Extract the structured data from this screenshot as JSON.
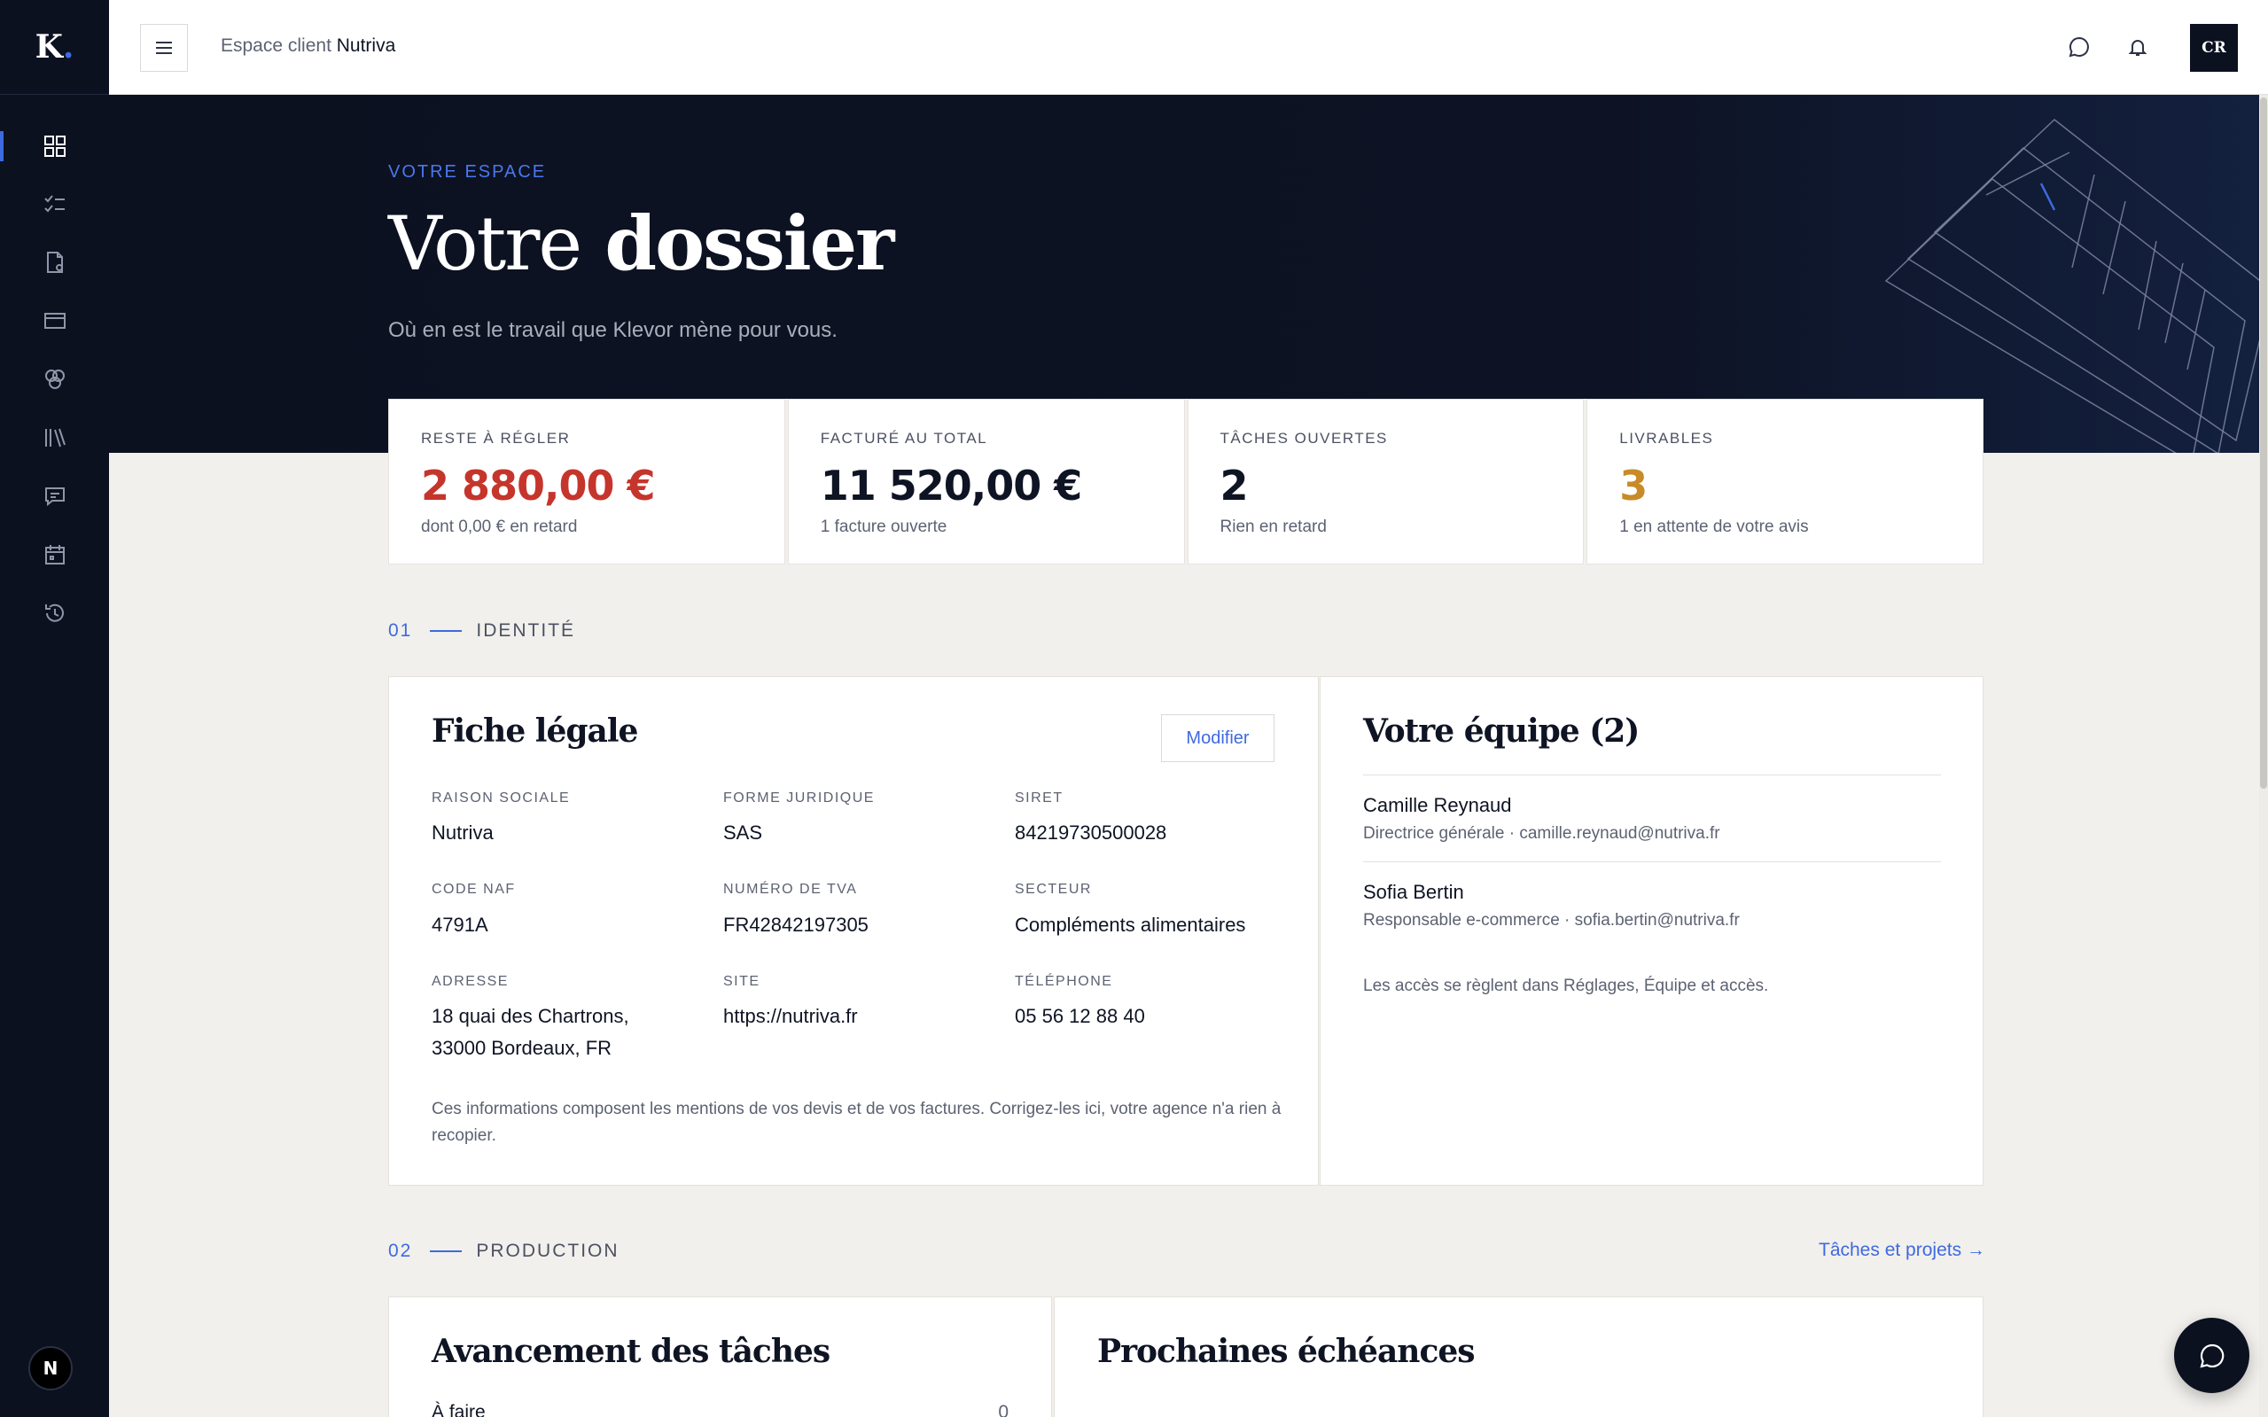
{
  "brand": {
    "logo_letter": "K",
    "logo_dot": "."
  },
  "sidebar": {
    "items": [
      {
        "icon": "dashboard-icon",
        "active": true
      },
      {
        "icon": "tasks-icon",
        "active": false
      },
      {
        "icon": "document-icon",
        "active": false
      },
      {
        "icon": "card-icon",
        "active": false
      },
      {
        "icon": "circles-icon",
        "active": false
      },
      {
        "icon": "library-icon",
        "active": false
      },
      {
        "icon": "message-icon",
        "active": false
      },
      {
        "icon": "calendar-icon",
        "active": false
      },
      {
        "icon": "history-icon",
        "active": false
      }
    ],
    "user_initial": "N"
  },
  "topbar": {
    "crumb_prefix": "Espace client",
    "crumb_client": "Nutriva",
    "user_initials": "CR"
  },
  "hero": {
    "eyebrow": "VOTRE ESPACE",
    "title_light": "Votre",
    "title_bold": "dossier",
    "subtitle": "Où en est le travail que Klevor mène pour vous."
  },
  "stats": [
    {
      "label": "RESTE À RÉGLER",
      "value": "2 880,00 €",
      "sub": "dont 0,00 € en retard",
      "tone": "red"
    },
    {
      "label": "FACTURÉ AU TOTAL",
      "value": "11 520,00 €",
      "sub": "1 facture ouverte",
      "tone": "default"
    },
    {
      "label": "TÂCHES OUVERTES",
      "value": "2",
      "sub": "Rien en retard",
      "tone": "default"
    },
    {
      "label": "LIVRABLES",
      "value": "3",
      "sub": "1 en attente de votre avis",
      "tone": "gold"
    }
  ],
  "section_identity": {
    "num": "01",
    "label": "IDENTITÉ"
  },
  "legal": {
    "title_light": "Fiche",
    "title_bold": "légale",
    "modify_label": "Modifier",
    "fields": [
      {
        "label": "RAISON SOCIALE",
        "value": "Nutriva"
      },
      {
        "label": "FORME JURIDIQUE",
        "value": "SAS"
      },
      {
        "label": "SIRET",
        "value": "84219730500028"
      },
      {
        "label": "CODE NAF",
        "value": "4791A"
      },
      {
        "label": "NUMÉRO DE TVA",
        "value": "FR42842197305"
      },
      {
        "label": "SECTEUR",
        "value": "Compléments alimentaires"
      },
      {
        "label": "ADRESSE",
        "value_line1": "18 quai des Chartrons,",
        "value_line2": "33000 Bordeaux, FR"
      },
      {
        "label": "SITE",
        "value": "https://nutriva.fr"
      },
      {
        "label": "TÉLÉPHONE",
        "value": "05 56 12 88 40"
      }
    ],
    "note": "Ces informations composent les mentions de vos devis et de vos factures. Corrigez-les ici, votre agence n'a rien à recopier."
  },
  "team": {
    "title_light": "Votre",
    "title_bold": "équipe (2)",
    "members": [
      {
        "name": "Camille Reynaud",
        "role": "Directrice générale · camille.reynaud@nutriva.fr"
      },
      {
        "name": "Sofia Bertin",
        "role": "Responsable e-commerce · sofia.bertin@nutriva.fr"
      }
    ],
    "note": "Les accès se règlent dans Réglages, Équipe et accès."
  },
  "section_production": {
    "num": "02",
    "label": "PRODUCTION",
    "link": "Tâches et projets →"
  },
  "tasks_card": {
    "title_light": "Avancement",
    "title_bold": "des tâches",
    "rows": [
      {
        "label": "À faire",
        "value": "0"
      }
    ]
  },
  "deadlines_card": {
    "title_light": "Prochaines",
    "title_bold": "échéances"
  },
  "colors": {
    "accent": "#3e6ae1",
    "navy": "#0c1120",
    "red": "#c5352c",
    "gold": "#c98a28"
  }
}
